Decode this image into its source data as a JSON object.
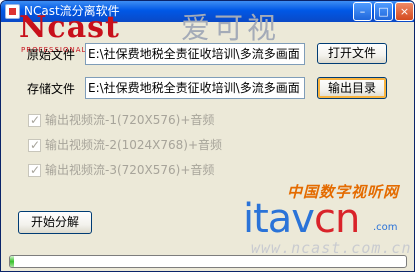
{
  "window": {
    "title": "NCast流分离软件",
    "brand_text": "Ncast",
    "brand_subtext": "PROFESSIONAL",
    "brand_cn": "爱可视",
    "accent_color": "#0058e6",
    "controls": {
      "minimize": "–",
      "maximize": "□",
      "close": "×"
    }
  },
  "source": {
    "label": "原始文件",
    "value": "E:\\社保费地税全责征收培训\\多流多画面",
    "button": "打开文件"
  },
  "output": {
    "label": "存储文件",
    "value": "E:\\社保费地税全责征收培训\\多流多画面",
    "button": "输出目录"
  },
  "options": [
    {
      "label": "输出视频流-1(720X576)+音频",
      "checked": true,
      "enabled": false
    },
    {
      "label": "输出视频流-2(1024X768)+音频",
      "checked": true,
      "enabled": false
    },
    {
      "label": "输出视频流-3(720X576)+音频",
      "checked": true,
      "enabled": false
    }
  ],
  "start_button": "开始分解",
  "watermark": {
    "site_cn": "中国数字视听网",
    "logo_left": "itav",
    "logo_right": "cn",
    "logo_suffix": ".com",
    "url": "www.ncast.com.cn"
  },
  "progress": {
    "value": 0.01
  }
}
